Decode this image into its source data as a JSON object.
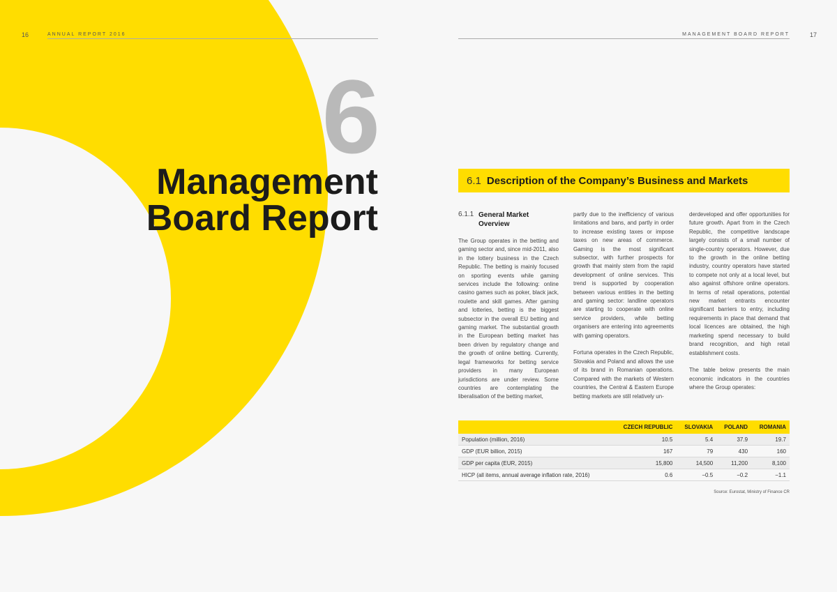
{
  "colors": {
    "accent": "#ffdd00",
    "chapter_number": "#b9b9b9",
    "text": "#1c1c1c"
  },
  "left_page": {
    "page_number": "16",
    "running_head": "ANNUAL REPORT 2016",
    "chapter_number": "6",
    "chapter_title_line1": "Management",
    "chapter_title_line2": "Board Report"
  },
  "right_page": {
    "page_number": "17",
    "running_head": "MANAGEMENT BOARD REPORT",
    "section": {
      "number": "6.1",
      "title": "Description of the Company’s Business and Markets"
    },
    "subsection": {
      "number": "6.1.1",
      "title": "General Market Overview"
    },
    "col1_p1": "The Group operates in the betting and gaming sector and, since mid-2011, also in the lottery business in the Czech Republic. The betting is mainly focused on sporting events while gaming services include the following: online casino games such as poker, black jack, roulette and skill games. After gaming and lotteries, betting is the biggest subsector in the overall EU betting and gaming market. The substantial growth in the European betting market has been driven by regulatory change and the growth of online betting. Currently, legal frameworks for betting service providers in many European jurisdictions are under review. Some countries are contemplating the liberalisation of the betting market,",
    "col2_p1": "partly due to the inefficiency of various limitations and bans, and partly in order to increase existing taxes or impose taxes on new areas of commerce. Gaming is the most significant subsector, with further prospects for growth that mainly stem from the rapid development of online services. This trend is supported by cooperation between various entities in the betting and gaming sector: landline operators are starting to cooperate with online service providers, while betting organisers are entering into agreements with gaming operators.",
    "col2_p2": "Fortuna operates in the Czech Republic, Slovakia and Poland and allows the use of its brand in Romanian operations. Compared with the markets of Western countries, the Central & Eastern Europe betting markets are still relatively un-",
    "col3_p1": "derdeveloped and offer opportunities for future growth. Apart from in the Czech Republic, the competitive landscape largely consists of a small number of single-country operators. However, due to the growth in the online betting industry, country operators have started to compete not only at a local level, but also against offshore online operators. In terms of retail operations, potential new market entrants encounter significant barriers to entry, including requirements in place that demand that local licences are obtained, the high marketing spend necessary to build brand recognition, and high retail establishment costs.",
    "col3_p2": "The table below presents the main economic indicators in the countries where the Group operates:",
    "table": {
      "headers": [
        "",
        "CZECH REPUBLIC",
        "SLOVAKIA",
        "POLAND",
        "ROMANIA"
      ],
      "rows": [
        [
          "Population (million, 2016)",
          "10.5",
          "5.4",
          "37.9",
          "19.7"
        ],
        [
          "GDP (EUR billion, 2015)",
          "167",
          "79",
          "430",
          "160"
        ],
        [
          "GDP per capita (EUR, 2015)",
          "15,800",
          "14,500",
          "11,200",
          "8,100"
        ],
        [
          "HICP (all items, annual average inflation rate, 2016)",
          "0.6",
          "−0.5",
          "−0.2",
          "−1.1"
        ]
      ]
    },
    "source": "Source: Eurostat, Ministry of Finance CR"
  }
}
